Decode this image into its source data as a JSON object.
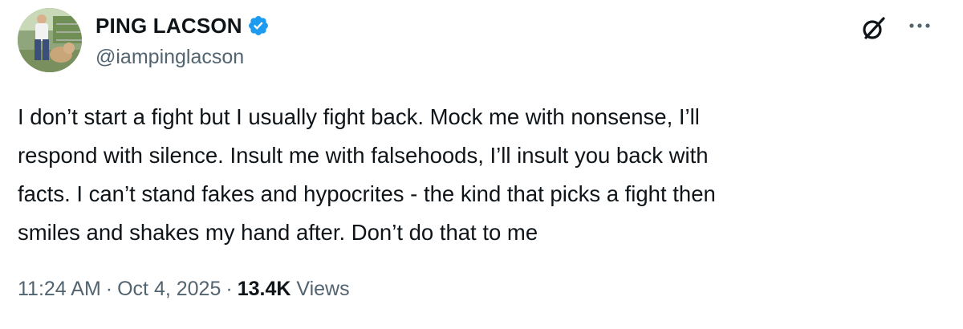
{
  "author": {
    "display_name": "PING LACSON",
    "handle": "@iampinglacson",
    "verified": true,
    "verified_color": "#1d9bf0"
  },
  "tweet": {
    "text": "I don’t start a fight but I usually fight back. Mock me with nonsense, I’ll\nrespond with silence. Insult me with falsehoods, I’ll insult you back with\nfacts. I can’t stand fakes and hypocrites - the kind that picks a fight then\nsmiles and shakes my hand after. Don’t do that to me"
  },
  "meta": {
    "time": "11:24 AM",
    "separator": "·",
    "date": "Oct 4, 2025",
    "views_count": "13.4K",
    "views_label": "Views"
  },
  "icons": {
    "grok": "grok-icon",
    "more": "more-options-icon",
    "verified": "verified-badge-icon"
  },
  "colors": {
    "text_primary": "#0f1419",
    "text_secondary": "#536471",
    "background": "#ffffff"
  }
}
